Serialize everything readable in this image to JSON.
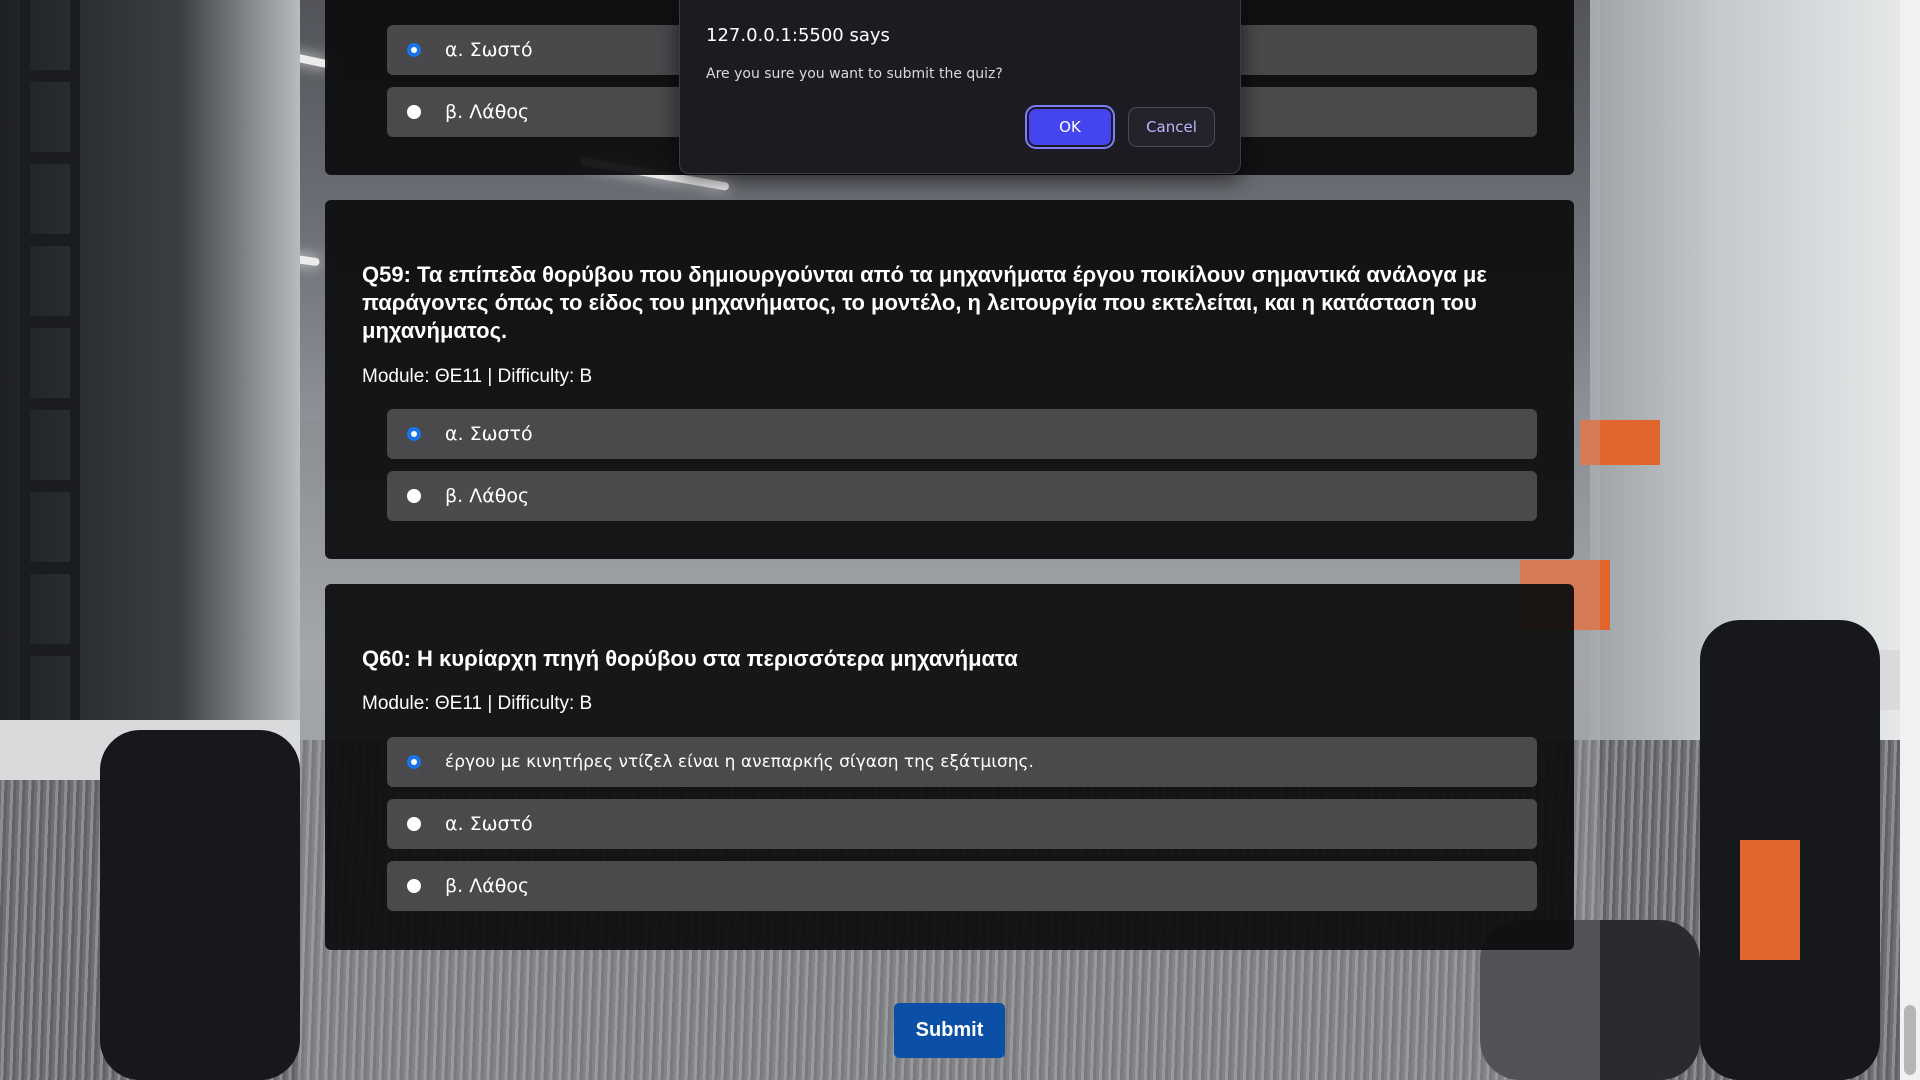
{
  "dialog": {
    "origin": "127.0.0.1:5500 says",
    "message": "Are you sure you want to submit the quiz?",
    "ok_label": "OK",
    "cancel_label": "Cancel"
  },
  "questions": [
    {
      "title": "",
      "meta": "",
      "options": [
        {
          "label": "α. Σωστό",
          "checked": true
        },
        {
          "label": "β. Λάθος",
          "checked": false
        }
      ]
    },
    {
      "title": "Q59: Τα επίπεδα θορύβου που δημιουργούνται από τα μηχανήματα έργου ποικίλουν σημαντικά ανάλογα με παράγοντες όπως το είδος του μηχανήματος, το μοντέλο, η λειτουργία που εκτελείται, και η κατάσταση του μηχανήματος.",
      "meta": "Module: ΘΕ11 | Difficulty: B",
      "options": [
        {
          "label": "α. Σωστό",
          "checked": true
        },
        {
          "label": "β. Λάθος",
          "checked": false
        }
      ]
    },
    {
      "title": "Q60: Η κυρίαρχη πηγή θορύβου στα περισσότερα μηχανήματα",
      "meta": "Module: ΘΕ11 | Difficulty: B",
      "options": [
        {
          "label": "έργου με κινητήρες ντίζελ είναι η ανεπαρκής σίγαση της εξάτμισης.",
          "checked": true
        },
        {
          "label": "α. Σωστό",
          "checked": false
        },
        {
          "label": "β. Λάθος",
          "checked": false
        }
      ]
    }
  ],
  "submit_label": "Submit",
  "colors": {
    "radio_checked": "#1a73e8",
    "submit_bg": "#0b4fa6",
    "ok_bg": "#4545f0"
  }
}
